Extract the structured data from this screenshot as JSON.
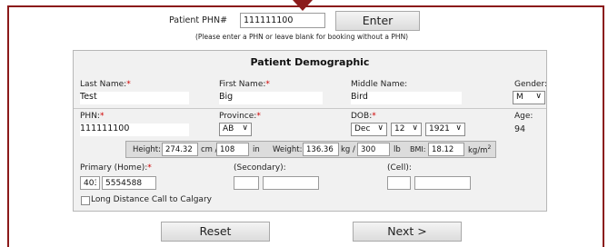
{
  "phn_lookup": {
    "label": "Patient PHN#",
    "value": "111111100",
    "enter_label": "Enter",
    "hint": "(Please enter a PHN or leave blank for booking without a PHN)"
  },
  "demographic": {
    "title": "Patient Demographic",
    "last_name_label": "Last Name:",
    "last_name_value": "Test",
    "first_name_label": "First Name:",
    "first_name_value": "Big",
    "middle_name_label": "Middle Name:",
    "middle_name_value": "Bird",
    "gender_label": "Gender:",
    "gender_value": "M",
    "phn_label": "PHN:",
    "phn_value": "111111100",
    "province_label": "Province:",
    "province_value": "AB",
    "dob_label": "DOB:",
    "dob_month": "Dec",
    "dob_day": "12",
    "dob_year": "1921",
    "age_label": "Age:",
    "age_value": "94",
    "required_mark": "*"
  },
  "measurements": {
    "height_label": "Height:",
    "height_cm": "274.32",
    "cm_unit": "cm /",
    "height_in": "108",
    "in_unit": "in",
    "weight_label": "Weight:",
    "weight_kg": "136.36",
    "kg_unit": "kg /",
    "weight_lb": "300",
    "lb_unit": "lb",
    "bmi_label": "BMI:",
    "bmi_value": "18.12",
    "bmi_unit": "kg/m",
    "bmi_unit_sup": "2"
  },
  "phones": {
    "primary_label": "Primary (Home):",
    "primary_area": "403",
    "primary_number": "5554588",
    "secondary_label": "(Secondary):",
    "secondary_area": "",
    "secondary_number": "",
    "cell_label": "(Cell):",
    "cell_area": "",
    "cell_number": "",
    "long_distance_label": "Long Distance Call to Calgary"
  },
  "actions": {
    "reset_label": "Reset",
    "next_label": "Next >"
  },
  "colors": {
    "frame": "#8b1a1a",
    "required": "#d00000"
  }
}
